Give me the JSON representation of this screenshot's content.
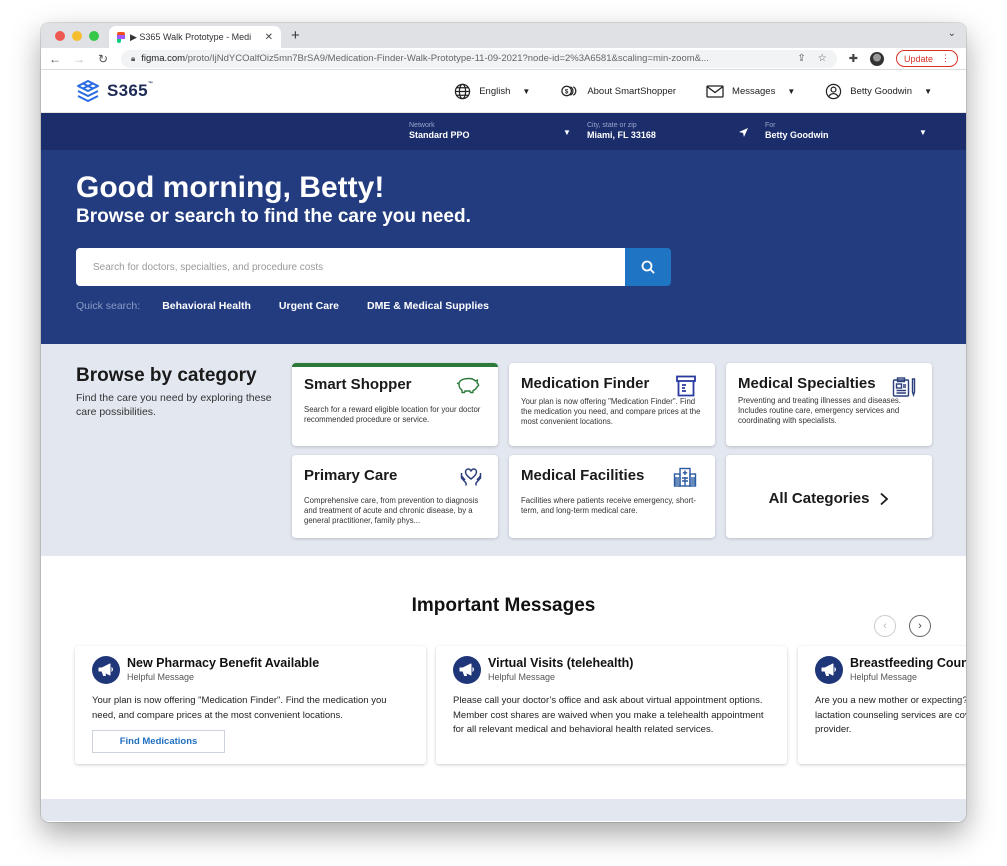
{
  "browser": {
    "tab_title": "▶ S365 Walk Prototype - Medi",
    "url_host": "figma.com",
    "url_path": "/proto/IjNdYCOalfOiz5mn7BrSA9/Medication-Finder-Walk-Prototype-11-09-2021?node-id=2%3A6581&scaling=min-zoom&...",
    "update_label": "Update"
  },
  "header": {
    "logo_text": "S365",
    "logo_tm": "™",
    "language": "English",
    "about": "About SmartShopper",
    "messages": "Messages",
    "user": "Betty Goodwin"
  },
  "location_bar": {
    "network_label": "Network",
    "network_value": "Standard PPO",
    "city_label": "City, state or zip",
    "city_value": "Miami, FL 33168",
    "for_label": "For",
    "for_value": "Betty Goodwin"
  },
  "hero": {
    "greeting": "Good morning, Betty!",
    "subtitle": "Browse or search to find the care you need.",
    "search_placeholder": "Search for doctors, specialties, and procedure costs",
    "search_value": "",
    "quick_label": "Quick search:",
    "quick_links": [
      "Behavioral Health",
      "Urgent Care",
      "DME & Medical Supplies"
    ]
  },
  "browse": {
    "title": "Browse by category",
    "description": "Find the care you need by exploring these care possibilities.",
    "categories": [
      {
        "title": "Smart Shopper",
        "desc": "Search for a reward eligible location for your doctor recommended procedure or service.",
        "icon": "piggy-bank-icon",
        "color": "#2b7a3a"
      },
      {
        "title": "Medication Finder",
        "desc": "Your plan is now offering \"Medication Finder\". Find the medication you need, and compare prices at the most convenient locations.",
        "icon": "pill-bottle-icon",
        "color": "#2a3aa0"
      },
      {
        "title": "Medical Specialties",
        "desc": "Preventing and treating illnesses and diseases. Includes routine care, emergency services and coordinating with specialists.",
        "icon": "clipboard-icon",
        "color": "#2a3f7a"
      },
      {
        "title": "Primary Care",
        "desc": "Comprehensive care, from prevention to diagnosis and treatment of acute and chronic disease, by a general practitioner, family phys...",
        "icon": "heart-hands-icon",
        "color": "#2a3f7a"
      },
      {
        "title": "Medical Facilities",
        "desc": "Facilities where patients receive emergency, short-term, and long-term medical care.",
        "icon": "hospital-icon",
        "color": "#2a5aa0"
      }
    ],
    "all_label": "All Categories"
  },
  "messages": {
    "title": "Important Messages",
    "items": [
      {
        "title": "New Pharmacy Benefit Available",
        "subtitle": "Helpful Message",
        "body": "Your plan is now offering \"Medication Finder\". Find the medication you need, and compare prices at the most convenient locations.",
        "button": "Find Medications"
      },
      {
        "title": "Virtual Visits (telehealth)",
        "subtitle": "Helpful Message",
        "body": "Please call your doctor’s office and ask about virtual appointment options. Member cost shares are waived when you make a telehealth appointment for all relevant medical and behavioral health related services."
      },
      {
        "title": "Breastfeeding Counseling",
        "subtitle": "Helpful Message",
        "body": "Are you a new mother or expecting? Lactation, breastfeeding support and lactation counseling services are covered at no cost for a trained, network provider."
      }
    ]
  },
  "colors": {
    "navy": "#1b2d6b",
    "hero": "#223c7f",
    "accent_blue": "#1f74c4",
    "smart_shopper_green": "#2b7a3a",
    "update_red": "#d93025"
  }
}
